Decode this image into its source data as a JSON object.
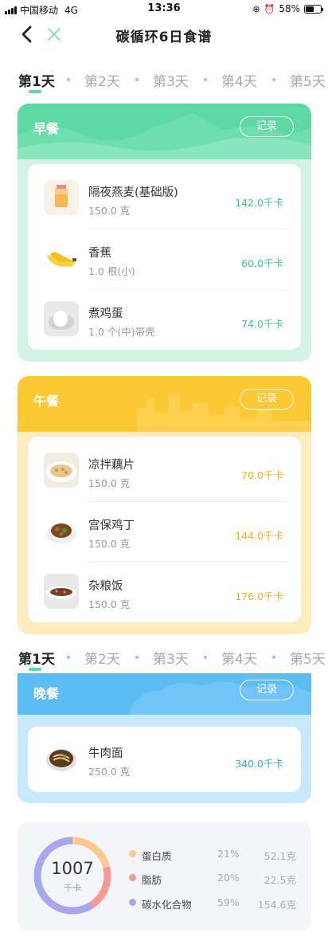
{
  "status_bar": {
    "carrier": "中国移动",
    "network": "4G",
    "time": "13:36",
    "battery": "58%"
  },
  "nav": {
    "title": "碳循环6日食谱"
  },
  "day_tabs": {
    "top": [
      "第1天",
      "第2天",
      "第3天",
      "第4天",
      "第5天"
    ],
    "sticky": [
      "第1天",
      "第2天",
      "第3天",
      "第4天",
      "第5天"
    ],
    "active_index": 0
  },
  "breakfast": {
    "title": "早餐",
    "record_label": "记录",
    "color": "#5ed8a4",
    "items": [
      {
        "name": "隔夜燕麦(基础版)",
        "qty": "150.0 克",
        "kcal": "142.0千卡",
        "icon": "overnight-oats"
      },
      {
        "name": "香蕉",
        "qty": "1.0 根(小)",
        "kcal": "60.0千卡",
        "icon": "banana"
      },
      {
        "name": "煮鸡蛋",
        "qty": "1.0 个(中)带壳",
        "kcal": "74.0千卡",
        "icon": "boiled-egg"
      }
    ]
  },
  "lunch": {
    "title": "午餐",
    "record_label": "记录",
    "color": "#fcc834",
    "items": [
      {
        "name": "凉拌藕片",
        "qty": "150.0 克",
        "kcal": "70.0千卡",
        "icon": "lotus-root-salad"
      },
      {
        "name": "宫保鸡丁",
        "qty": "150.0 克",
        "kcal": "144.0千卡",
        "icon": "kung-pao-chicken"
      },
      {
        "name": "杂粮饭",
        "qty": "150.0 克",
        "kcal": "176.0千卡",
        "icon": "multigrain-rice"
      }
    ]
  },
  "dinner": {
    "title": "晚餐",
    "record_label": "记录",
    "color": "#5cbcf4",
    "items": [
      {
        "name": "牛肉面",
        "qty": "250.0 克",
        "kcal": "340.0千卡",
        "icon": "beef-noodles"
      }
    ]
  },
  "summary": {
    "total": "1007",
    "unit": "千卡",
    "nutrients": [
      {
        "label": "蛋白质",
        "percent": "21%",
        "grams": "52.1克",
        "color": "#fbc98f",
        "share": 0.21
      },
      {
        "label": "脂肪",
        "percent": "20%",
        "grams": "22.5克",
        "color": "#f49a92",
        "share": 0.2
      },
      {
        "label": "碳水化合物",
        "percent": "59%",
        "grams": "154.6克",
        "color": "#a7a7ef",
        "share": 0.59
      }
    ]
  }
}
